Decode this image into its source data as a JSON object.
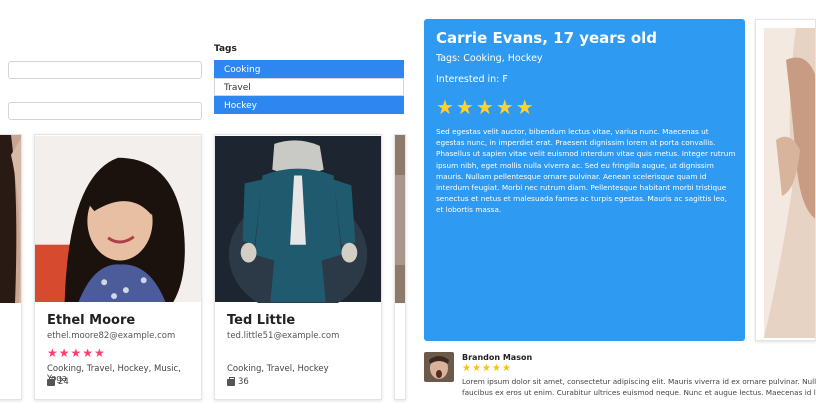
{
  "filters": {
    "tags_label": "Tags",
    "tag_options": [
      {
        "label": "Cooking",
        "selected": true
      },
      {
        "label": "Travel",
        "selected": false
      },
      {
        "label": "Hockey",
        "selected": true
      }
    ]
  },
  "cards": [
    {
      "name": "Ethel Moore",
      "email": "ethel.moore82@example.com",
      "rating": 5,
      "stars": "★★★★★",
      "tags": "Cooking, Travel, Hockey, Music, Yoga",
      "count": "24"
    },
    {
      "name": "Ted Little",
      "email": "ted.little51@example.com",
      "rating": 0,
      "stars": "",
      "tags": "Cooking, Travel, Hockey",
      "count": "36"
    }
  ],
  "detail": {
    "title": "Carrie Evans, 17 years old",
    "tags": "Tags: Cooking, Hockey",
    "interested_in": "Interested in: F",
    "rating": 5,
    "stars": "★★★★★",
    "bio": "Sed egestas velit auctor, bibendum lectus vitae, varius nunc. Maecenas ut egestas nunc, in imperdiet erat. Praesent dignissim lorem at porta convallis. Phasellus ut sapien vitae velit euismod interdum vitae quis metus. Integer rutrum ipsum nibh, eget mollis nulla viverra ac. Sed eu fringilla augue, ut dignissim mauris. Nullam pellentesque ornare pulvinar. Aenean scelerisque quam id interdum feugiat. Morbi nec rutrum diam. Pellentesque habitant morbi tristique senectus et netus et malesuada fames ac turpis egestas. Mauris ac sagittis leo, et lobortis massa."
  },
  "review": {
    "author": "Brandon Mason",
    "rating": 5,
    "stars": "★★★★★",
    "line1": "Lorem ipsum dolor sit amet, consectetur adipiscing elit. Mauris viverra id ex ornare pulvinar. Nulla",
    "line2": "faucibus ex eros ut enim. Curabitur ultrices euismod neque. Nunc et augue lectus. Maecenas id leo"
  },
  "colors": {
    "accent": "#2e87f0",
    "panel": "#2e9af2",
    "card_star": "#ff3d6e",
    "panel_star": "#ffd22a"
  }
}
